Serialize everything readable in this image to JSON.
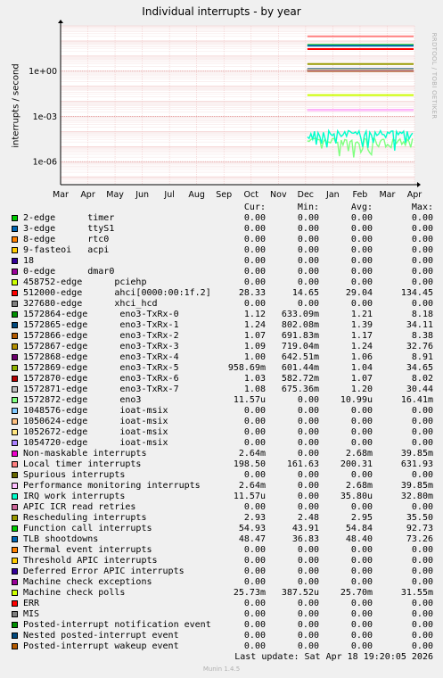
{
  "chart_data": {
    "type": "line",
    "title": "Individual interrupts - by year",
    "ylabel": "interrupts / second",
    "yscale": "log",
    "ylim": [
      3e-08,
      1000
    ],
    "yticks": [
      {
        "v": 1,
        "label": "1e+00"
      },
      {
        "v": 0.001,
        "label": "1e-03"
      },
      {
        "v": 1e-06,
        "label": "1e-06"
      }
    ],
    "x_tick_labels": [
      "Mar",
      "Apr",
      "May",
      "Jun",
      "Jul",
      "Aug",
      "Sep",
      "Oct",
      "Nov",
      "Dec",
      "Jan",
      "Feb",
      "Mar",
      "Apr"
    ],
    "data_start_label": "Dec",
    "grid": true,
    "watermark": "RRDTOOL / TOBI OETIKER",
    "columns": [
      "Cur:",
      "Min:",
      "Avg:",
      "Max:"
    ],
    "series": [
      {
        "name": "2-edge      timer",
        "color": "#00cc00",
        "cur": "0.00",
        "min": "0.00",
        "avg": "0.00",
        "max": "0.00"
      },
      {
        "name": "3-edge      ttyS1",
        "color": "#0066b3",
        "cur": "0.00",
        "min": "0.00",
        "avg": "0.00",
        "max": "0.00"
      },
      {
        "name": "8-edge      rtc0",
        "color": "#ff8000",
        "cur": "0.00",
        "min": "0.00",
        "avg": "0.00",
        "max": "0.00"
      },
      {
        "name": "9-fasteoi   acpi",
        "color": "#ffcc00",
        "cur": "0.00",
        "min": "0.00",
        "avg": "0.00",
        "max": "0.00"
      },
      {
        "name": "18",
        "color": "#330099",
        "cur": "0.00",
        "min": "0.00",
        "avg": "0.00",
        "max": "0.00"
      },
      {
        "name": "0-edge      dmar0",
        "color": "#990099",
        "cur": "0.00",
        "min": "0.00",
        "avg": "0.00",
        "max": "0.00"
      },
      {
        "name": "458752-edge      pciehp",
        "color": "#ccff00",
        "cur": "0.00",
        "min": "0.00",
        "avg": "0.00",
        "max": "0.00"
      },
      {
        "name": "512000-edge      ahci[0000:00:1f.2]",
        "color": "#ff0000",
        "cur": "28.33",
        "min": "14.65",
        "avg": "29.04",
        "max": "134.45"
      },
      {
        "name": "327680-edge      xhci_hcd",
        "color": "#808080",
        "cur": "0.00",
        "min": "0.00",
        "avg": "0.00",
        "max": "0.00"
      },
      {
        "name": "1572864-edge      eno3-TxRx-0",
        "color": "#008f00",
        "cur": "1.12",
        "min": "633.09m",
        "avg": "1.21",
        "max": "8.18"
      },
      {
        "name": "1572865-edge      eno3-TxRx-1",
        "color": "#00487d",
        "cur": "1.24",
        "min": "802.08m",
        "avg": "1.39",
        "max": "34.11"
      },
      {
        "name": "1572866-edge      eno3-TxRx-2",
        "color": "#b35a00",
        "cur": "1.07",
        "min": "691.83m",
        "avg": "1.17",
        "max": "8.38"
      },
      {
        "name": "1572867-edge      eno3-TxRx-3",
        "color": "#b38f00",
        "cur": "1.09",
        "min": "719.04m",
        "avg": "1.24",
        "max": "32.76"
      },
      {
        "name": "1572868-edge      eno3-TxRx-4",
        "color": "#6b006b",
        "cur": "1.00",
        "min": "642.51m",
        "avg": "1.06",
        "max": "8.91"
      },
      {
        "name": "1572869-edge      eno3-TxRx-5",
        "color": "#8fb300",
        "cur": "958.69m",
        "min": "601.44m",
        "avg": "1.04",
        "max": "34.65"
      },
      {
        "name": "1572870-edge      eno3-TxRx-6",
        "color": "#b30000",
        "cur": "1.03",
        "min": "582.72m",
        "avg": "1.07",
        "max": "8.02"
      },
      {
        "name": "1572871-edge      eno3-TxRx-7",
        "color": "#bebebe",
        "cur": "1.08",
        "min": "675.36m",
        "avg": "1.20",
        "max": "30.44"
      },
      {
        "name": "1572872-edge      eno3",
        "color": "#80ff80",
        "cur": "11.57u",
        "min": "0.00",
        "avg": "10.99u",
        "max": "16.41m"
      },
      {
        "name": "1048576-edge      ioat-msix",
        "color": "#80c9ff",
        "cur": "0.00",
        "min": "0.00",
        "avg": "0.00",
        "max": "0.00"
      },
      {
        "name": "1050624-edge      ioat-msix",
        "color": "#ffc080",
        "cur": "0.00",
        "min": "0.00",
        "avg": "0.00",
        "max": "0.00"
      },
      {
        "name": "1052672-edge      ioat-msix",
        "color": "#ffe680",
        "cur": "0.00",
        "min": "0.00",
        "avg": "0.00",
        "max": "0.00"
      },
      {
        "name": "1054720-edge      ioat-msix",
        "color": "#aa80ff",
        "cur": "0.00",
        "min": "0.00",
        "avg": "0.00",
        "max": "0.00"
      },
      {
        "name": "Non-maskable interrupts",
        "color": "#ee00cc",
        "cur": "2.64m",
        "min": "0.00",
        "avg": "2.68m",
        "max": "39.85m"
      },
      {
        "name": "Local timer interrupts",
        "color": "#ff8080",
        "cur": "198.50",
        "min": "161.63",
        "avg": "200.31",
        "max": "631.93"
      },
      {
        "name": "Spurious interrupts",
        "color": "#666600",
        "cur": "0.00",
        "min": "0.00",
        "avg": "0.00",
        "max": "0.00"
      },
      {
        "name": "Performance monitoring interrupts",
        "color": "#ffbfff",
        "cur": "2.64m",
        "min": "0.00",
        "avg": "2.68m",
        "max": "39.85m"
      },
      {
        "name": "IRQ work interrupts",
        "color": "#00ffcc",
        "cur": "11.57u",
        "min": "0.00",
        "avg": "35.80u",
        "max": "32.80m"
      },
      {
        "name": "APIC ICR read retries",
        "color": "#cc6699",
        "cur": "0.00",
        "min": "0.00",
        "avg": "0.00",
        "max": "0.00"
      },
      {
        "name": "Rescheduling interrupts",
        "color": "#999900",
        "cur": "2.93",
        "min": "2.48",
        "avg": "2.95",
        "max": "35.50"
      },
      {
        "name": "Function call interrupts",
        "color": "#00cc00",
        "cur": "54.93",
        "min": "43.91",
        "avg": "54.84",
        "max": "92.73"
      },
      {
        "name": "TLB shootdowns",
        "color": "#0066b3",
        "cur": "48.47",
        "min": "36.83",
        "avg": "48.40",
        "max": "73.26"
      },
      {
        "name": "Thermal event interrupts",
        "color": "#ff8000",
        "cur": "0.00",
        "min": "0.00",
        "avg": "0.00",
        "max": "0.00"
      },
      {
        "name": "Threshold APIC interrupts",
        "color": "#ffcc00",
        "cur": "0.00",
        "min": "0.00",
        "avg": "0.00",
        "max": "0.00"
      },
      {
        "name": "Deferred Error APIC interrupts",
        "color": "#330099",
        "cur": "0.00",
        "min": "0.00",
        "avg": "0.00",
        "max": "0.00"
      },
      {
        "name": "Machine check exceptions",
        "color": "#990099",
        "cur": "0.00",
        "min": "0.00",
        "avg": "0.00",
        "max": "0.00"
      },
      {
        "name": "Machine check polls",
        "color": "#ccff00",
        "cur": "25.73m",
        "min": "387.52u",
        "avg": "25.70m",
        "max": "31.55m"
      },
      {
        "name": "ERR",
        "color": "#ff0000",
        "cur": "0.00",
        "min": "0.00",
        "avg": "0.00",
        "max": "0.00"
      },
      {
        "name": "MIS",
        "color": "#808080",
        "cur": "0.00",
        "min": "0.00",
        "avg": "0.00",
        "max": "0.00"
      },
      {
        "name": "Posted-interrupt notification event",
        "color": "#008f00",
        "cur": "0.00",
        "min": "0.00",
        "avg": "0.00",
        "max": "0.00"
      },
      {
        "name": "Nested posted-interrupt event",
        "color": "#00487d",
        "cur": "0.00",
        "min": "0.00",
        "avg": "0.00",
        "max": "0.00"
      },
      {
        "name": "Posted-interrupt wakeup event",
        "color": "#b35a00",
        "cur": "0.00",
        "min": "0.00",
        "avg": "0.00",
        "max": "0.00"
      }
    ],
    "last_update": "Last update:  Sat Apr 18 19:20:05 2026",
    "munin_version": "Munin 1.4.5"
  }
}
